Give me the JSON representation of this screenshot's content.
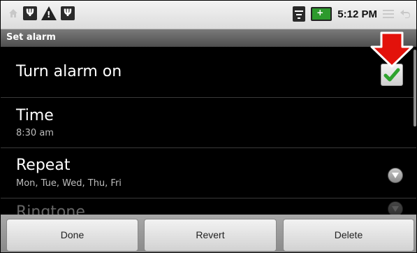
{
  "status_bar": {
    "time": "5:12 PM",
    "left_icons": [
      "home-icon",
      "usb-icon",
      "warning-icon",
      "usb-icon"
    ],
    "right_icons": [
      "wifi-icon",
      "battery-charging-icon",
      "menu-icon",
      "back-icon"
    ]
  },
  "title": "Set alarm",
  "settings": {
    "alarm_toggle": {
      "label": "Turn alarm on",
      "checked": true
    },
    "time": {
      "label": "Time",
      "value": "8:30 am"
    },
    "repeat": {
      "label": "Repeat",
      "value": "Mon, Tue, Wed, Thu, Fri"
    },
    "ringtone": {
      "label": "Ringtone"
    }
  },
  "buttons": {
    "done": "Done",
    "revert": "Revert",
    "delete": "Delete"
  },
  "colors": {
    "annotation_arrow": "#e3120b",
    "check": "#2ea32e"
  }
}
